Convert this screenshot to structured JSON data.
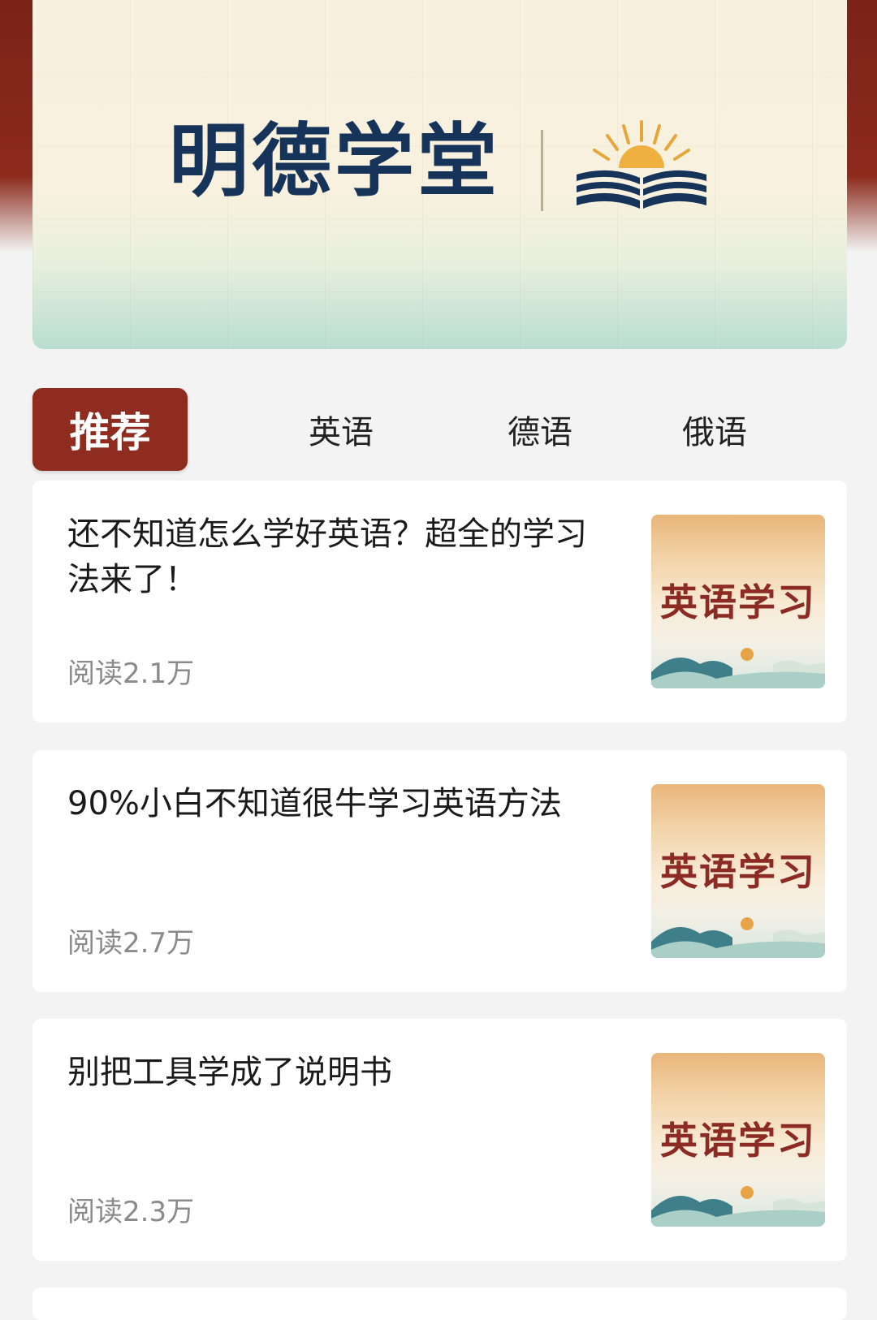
{
  "banner": {
    "title": "明德学堂",
    "logo_icon": "book-sunrise-icon"
  },
  "tabs": [
    {
      "label": "推荐",
      "active": true
    },
    {
      "label": "英语",
      "active": false
    },
    {
      "label": "德语",
      "active": false
    },
    {
      "label": "俄语",
      "active": false
    }
  ],
  "articles": [
    {
      "title": "还不知道怎么学好英语？超全的学习法来了！",
      "reads": "阅读2.1万",
      "thumb_label": "英语学习"
    },
    {
      "title": "90%小白不知道很牛学习英语方法",
      "reads": "阅读2.7万",
      "thumb_label": "英语学习"
    },
    {
      "title": "别把工具学成了说明书",
      "reads": "阅读2.3万",
      "thumb_label": "英语学习"
    }
  ],
  "colors": {
    "accent": "#8e2d1f",
    "title_navy": "#163459",
    "thumb_text": "#8c2a24"
  }
}
